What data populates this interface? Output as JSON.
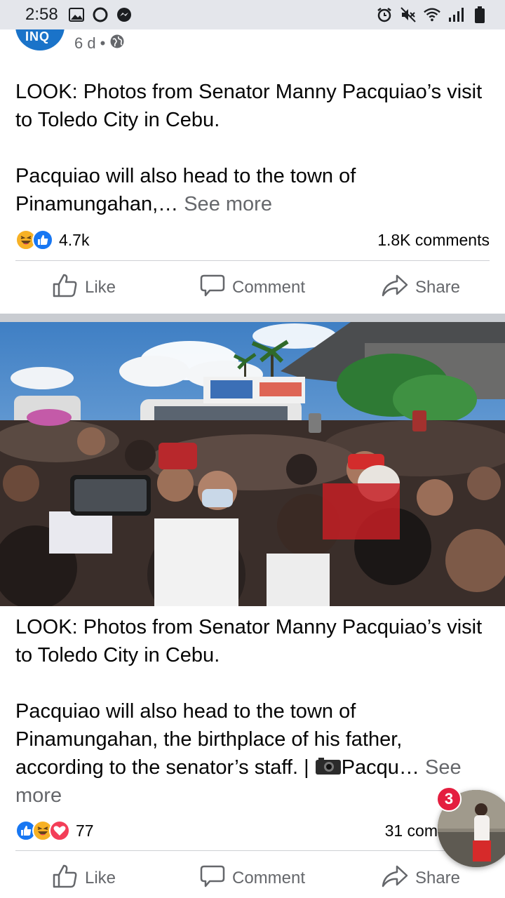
{
  "status_bar": {
    "time": "2:58",
    "left_icons": [
      "image-icon",
      "chat-bubble-icon",
      "messenger-icon"
    ],
    "right_icons": [
      "alarm-icon",
      "mute-icon",
      "wifi-icon",
      "signal-icon",
      "battery-icon"
    ]
  },
  "post1": {
    "time_ago": "6 d",
    "dot": "•",
    "privacy_icon": "globe-icon",
    "avatar_text": "INQ",
    "text_line1": "LOOK: Photos from Senator Manny Pacquiao’s visit to Toledo City in Cebu.",
    "text_line2": "Pacquiao will also head to the town of Pinamungahan,…",
    "see_more": "See more",
    "reactions_count": "4.7k",
    "reaction_icons": [
      "haha",
      "like"
    ],
    "comments": "1.8K comments",
    "like_label": "Like",
    "comment_label": "Comment",
    "share_label": "Share"
  },
  "post2": {
    "text_line1": "LOOK: Photos from Senator Manny Pacquiao’s visit to Toledo City in Cebu.",
    "text_line2": "Pacquiao will also head to the town of Pinamungahan, the birthplace of his father, according to the senator’s staff. |",
    "camera_emoji": "📷",
    "text_line3": "Pacqu…",
    "see_more": "See more",
    "reactions_count": "77",
    "reaction_icons": [
      "like",
      "haha",
      "love"
    ],
    "comments": "31 com",
    "like_label": "Like",
    "comment_label": "Comment",
    "share_label": "Share"
  },
  "chat_head": {
    "badge": "3"
  },
  "colors": {
    "facebook_blue": "#1877f2",
    "text_secondary": "#65676b",
    "divider": "#ced0d4",
    "status_bar_bg": "#e4e6eb",
    "badge_red": "#e41e3f"
  }
}
